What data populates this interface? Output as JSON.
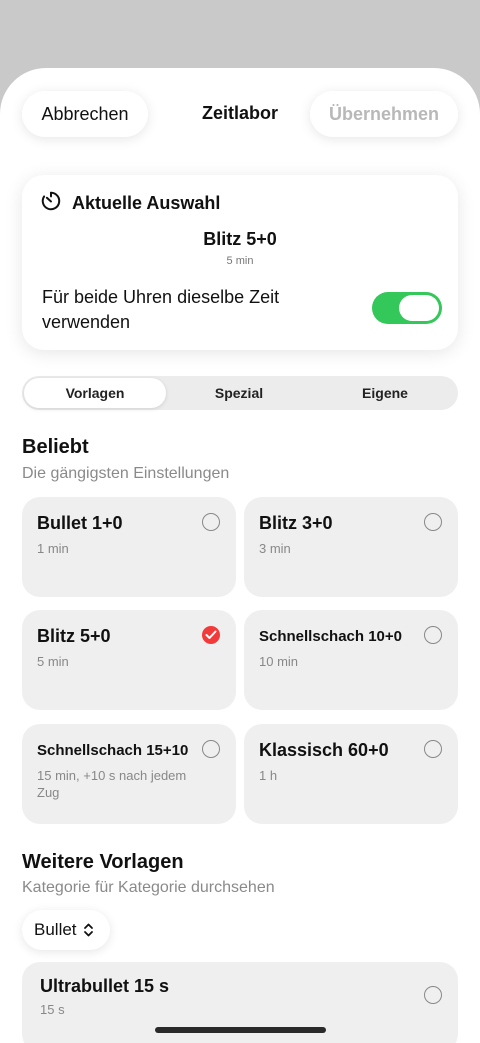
{
  "header": {
    "cancel_label": "Abbrechen",
    "title": "Zeitlabor",
    "apply_label": "Übernehmen"
  },
  "current": {
    "title": "Aktuelle Auswahl",
    "icon": "timer-icon",
    "name": "Blitz 5+0",
    "time": "5 min",
    "same_time_label": "Für beide Uhren dieselbe Zeit verwenden",
    "same_time_enabled": true
  },
  "tabs": [
    {
      "label": "Vorlagen",
      "active": true
    },
    {
      "label": "Spezial",
      "active": false
    },
    {
      "label": "Eigene",
      "active": false
    }
  ],
  "popular": {
    "title": "Beliebt",
    "subtitle": "Die gängigsten Einstellungen",
    "items": [
      {
        "name": "Bullet 1+0",
        "desc": "1 min",
        "selected": false
      },
      {
        "name": "Blitz 3+0",
        "desc": "3 min",
        "selected": false
      },
      {
        "name": "Blitz 5+0",
        "desc": "5 min",
        "selected": true
      },
      {
        "name": "Schnellschach 10+0",
        "desc": "10 min",
        "selected": false
      },
      {
        "name": "Schnellschach 15+10",
        "desc": "15 min, +10 s nach jedem Zug",
        "selected": false
      },
      {
        "name": "Klassisch 60+0",
        "desc": "1 h",
        "selected": false
      }
    ]
  },
  "more": {
    "title": "Weitere Vorlagen",
    "subtitle": "Kategorie für Kategorie durchsehen",
    "category": "Bullet",
    "items": [
      {
        "name": "Ultrabullet 15 s",
        "desc": "15 s",
        "selected": false
      }
    ]
  },
  "colors": {
    "accent": "#f23a3a",
    "toggle_on": "#34c759",
    "card_bg": "#efefef"
  }
}
